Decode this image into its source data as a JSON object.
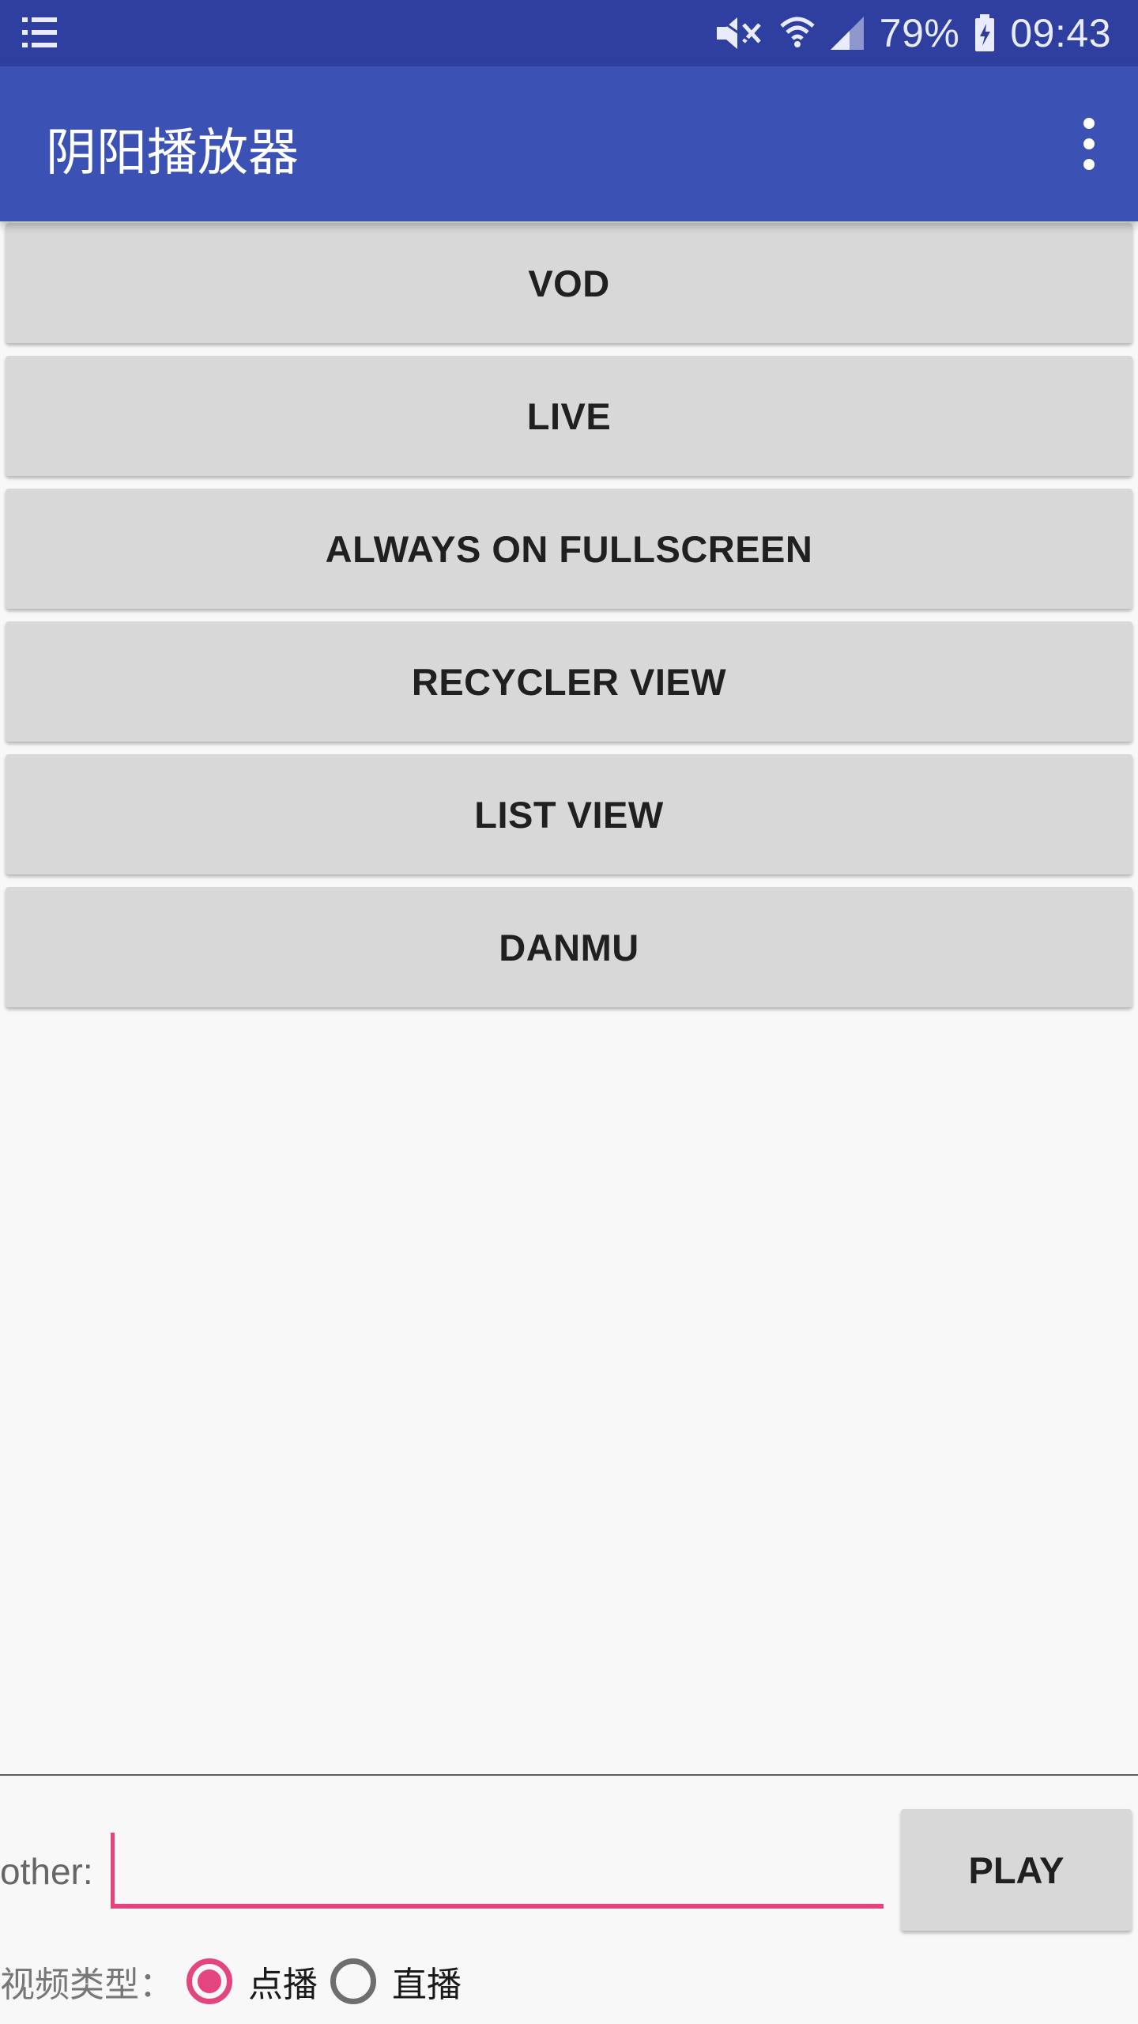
{
  "status_bar": {
    "battery": "79%",
    "time": "09:43",
    "icons": [
      "notification-list-icon",
      "mute-icon",
      "wifi-icon",
      "signal-icon",
      "battery-charging-icon"
    ]
  },
  "app_bar": {
    "title": "阴阳播放器",
    "menu_icon": "more-vert-icon"
  },
  "buttons": [
    {
      "label": "VOD"
    },
    {
      "label": "LIVE"
    },
    {
      "label": "ALWAYS ON FULLSCREEN"
    },
    {
      "label": "RECYCLER VIEW"
    },
    {
      "label": "LIST VIEW"
    },
    {
      "label": "DANMU"
    }
  ],
  "bottom": {
    "other_label": "other:",
    "input_value": "",
    "play_label": "PLAY",
    "type_label": "视频类型：",
    "radios": [
      {
        "label": "点播",
        "checked": true
      },
      {
        "label": "直播",
        "checked": false
      }
    ]
  },
  "colors": {
    "status_bar": "#2e3f9f",
    "app_bar": "#3b52b4",
    "accent": "#e5457f",
    "button_bg": "#d7d8d7"
  }
}
